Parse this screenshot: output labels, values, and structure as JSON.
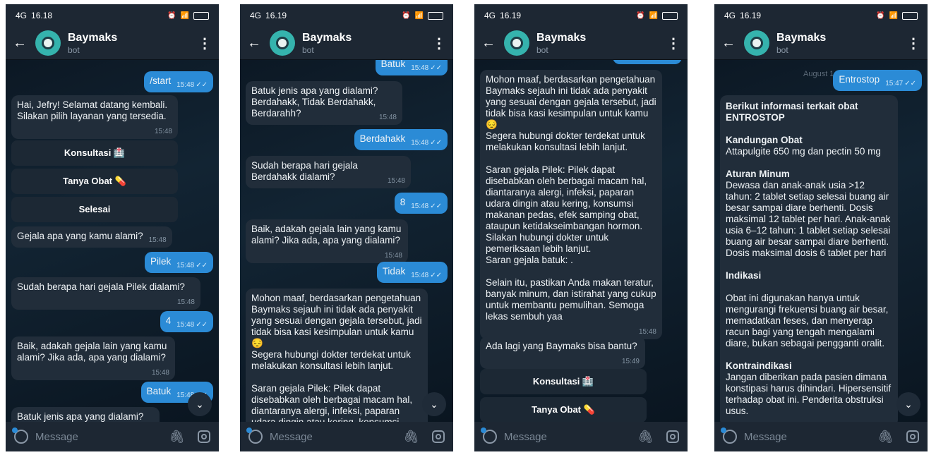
{
  "common": {
    "bot_name": "Baymaks",
    "bot_sub": "bot",
    "input_placeholder": "Message",
    "signal": "4G"
  },
  "s1": {
    "clock": "16.18",
    "msgs": {
      "start": "/start",
      "start_t": "15:48",
      "welcome": "Hai, Jefry! Selamat datang kembali. Silakan pilih layanan yang tersedia.",
      "welcome_t": "15:48",
      "btn_konsultasi": "Konsultasi 🏥",
      "btn_tanya": "Tanya Obat 💊",
      "btn_selesai": "Selesai",
      "q_gejala": "Gejala apa yang kamu alami?",
      "q_gejala_t": "15:48",
      "pilek": "Pilek",
      "pilek_t": "15:48",
      "q_hari": "Sudah berapa hari gejala Pilek dialami?",
      "q_hari_t": "15:48",
      "four": "4",
      "four_t": "15:48",
      "q_lain": "Baik, adakah gejala lain yang kamu alami? Jika ada, apa yang dialami?",
      "q_lain_t": "15:48",
      "batuk": "Batuk",
      "batuk_t": "15:48",
      "q_batuk": "Batuk jenis apa yang dialami?"
    }
  },
  "s2": {
    "clock": "16.19",
    "msgs": {
      "batuk": "Batuk",
      "batuk_t": "15:48",
      "q_batuk": "Batuk jenis apa yang dialami? Berdahakk, Tidak Berdahakk, Berdarahh?",
      "q_batuk_t": "15:48",
      "berdahak": "Berdahakk",
      "berdahak_t": "15:48",
      "q_hari": "Sudah berapa hari gejala Berdahakk dialami?",
      "q_hari_t": "15:48",
      "eight": "8",
      "eight_t": "15:48",
      "q_lain": "Baik, adakah gejala lain yang kamu alami? Jika ada, apa yang dialami?",
      "q_lain_t": "15:48",
      "tidak": "Tidak",
      "tidak_t": "15:48",
      "result_1": "Mohon maaf, berdasarkan pengetahuan Baymaks sejauh ini tidak ada penyakit yang sesuai dengan gejala tersebut, jadi tidak bisa kasi kesimpulan untuk kamu 😔",
      "result_2": "Segera hubungi dokter terdekat untuk melakukan konsultasi lebih lanjut.",
      "result_3": "Saran gejala Pilek: Pilek dapat disebabkan oleh berbagai macam hal, diantaranya alergi, infeksi, paparan udara dingin atau kering, konsumsi"
    }
  },
  "s3": {
    "clock": "16.19",
    "msgs": {
      "result_1": "Mohon maaf, berdasarkan pengetahuan Baymaks sejauh ini tidak ada penyakit yang sesuai dengan gejala tersebut, jadi tidak bisa kasi kesimpulan untuk kamu 😔",
      "result_2": "Segera hubungi dokter terdekat untuk melakukan konsultasi lebih lanjut.",
      "result_3": "Saran gejala Pilek: Pilek dapat disebabkan oleh berbagai macam hal, diantaranya alergi, infeksi, paparan udara dingin atau kering, konsumsi makanan pedas, efek samping obat, ataupun ketidakseimbangan hormon. Silakan hubungi dokter untuk pemeriksaan lebih lanjut.",
      "result_4": "Saran gejala batuk: .",
      "result_5": "Selain itu, pastikan Anda makan teratur, banyak minum, dan istirahat yang cukup untuk membantu pemulihan. Semoga lekas sembuh yaa",
      "result_t": "15:48",
      "ask_more": "Ada lagi yang Baymaks bisa bantu?",
      "ask_more_t": "15:49",
      "btn_konsultasi": "Konsultasi 🏥",
      "btn_tanya": "Tanya Obat 💊"
    }
  },
  "s4": {
    "clock": "16.19",
    "msgs": {
      "date_chip": "August 1",
      "entrostop": "Entrostop",
      "entrostop_t": "15:47",
      "title": "Berikut informasi terkait obat ENTROSTOP",
      "kandungan_h": "Kandungan Obat",
      "kandungan": "Attapulgite 650 mg dan pectin 50 mg",
      "aturan_h": "Aturan Minum",
      "aturan": "Dewasa dan anak-anak usia >12 tahun: 2 tablet setiap selesai buang air besar sampai diare berhenti. Dosis maksimal 12 tablet per hari. Anak-anak usia 6–12 tahun: 1 tablet setiap selesai buang air besar sampai diare berhenti. Dosis maksimal dosis 6 tablet per hari",
      "indikasi_h": "Indikasi",
      "indikasi": "Obat ini digunakan hanya untuk mengurangi frekuensi buang air besar, memadatkan feses, dan menyerap racun bagi yang tengah mengalami diare, bukan sebagai pengganti oralit.",
      "kontra_h": "Kontraindikasi",
      "kontra": "Jangan diberikan pada pasien dimana konstipasi harus dihindari. Hipersensitif terhadap obat ini. Penderita obstruksi usus."
    }
  }
}
